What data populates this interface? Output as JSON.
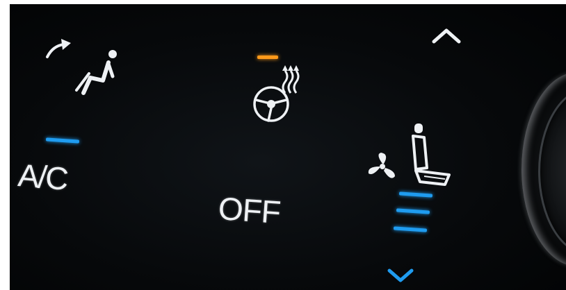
{
  "colors": {
    "panel_background": "#050708",
    "symbol_white": "#eef1f4",
    "indicator_blue": "#1f9cf0",
    "indicator_orange": "#ff9a1a"
  },
  "airflow_mode": {
    "icon": "seated-person-airflow-icon",
    "arrow_icon": "curved-arrow-icon"
  },
  "ac": {
    "label": "A/C",
    "indicator_color": "#1f9cf0"
  },
  "heated_steering": {
    "icon": "heated-steering-wheel-icon",
    "indicator_color": "#ff9a1a"
  },
  "off_button": {
    "label": "OFF"
  },
  "fan_speed": {
    "up_icon": "chevron-up-icon",
    "down_icon": "chevron-down-icon",
    "fan_icon": "fan-icon",
    "seat_icon": "seat-icon",
    "level_bars": 3
  }
}
